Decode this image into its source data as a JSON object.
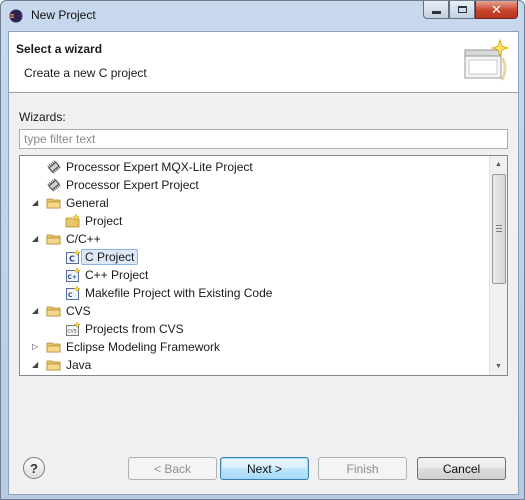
{
  "window": {
    "title": "New Project"
  },
  "banner": {
    "title": "Select a wizard",
    "description": "Create a new C project"
  },
  "wizards_label": "Wizards:",
  "filter": {
    "value": "",
    "placeholder": "type filter text"
  },
  "tree": {
    "items": [
      {
        "label": "Processor Expert MQX-Lite Project",
        "level": 0,
        "expander": "none",
        "icon": "chip-icon"
      },
      {
        "label": "Processor Expert Project",
        "level": 0,
        "expander": "none",
        "icon": "chip-icon"
      },
      {
        "label": "General",
        "level": 0,
        "expander": "expanded",
        "icon": "folder-icon"
      },
      {
        "label": "Project",
        "level": 1,
        "expander": "none",
        "icon": "project-icon"
      },
      {
        "label": "C/C++",
        "level": 0,
        "expander": "expanded",
        "icon": "folder-icon"
      },
      {
        "label": "C Project",
        "level": 1,
        "expander": "none",
        "icon": "c-project-icon",
        "selected": true
      },
      {
        "label": "C++ Project",
        "level": 1,
        "expander": "none",
        "icon": "cpp-project-icon"
      },
      {
        "label": "Makefile Project with Existing Code",
        "level": 1,
        "expander": "none",
        "icon": "makefile-project-icon"
      },
      {
        "label": "CVS",
        "level": 0,
        "expander": "expanded",
        "icon": "folder-icon"
      },
      {
        "label": "Projects from CVS",
        "level": 1,
        "expander": "none",
        "icon": "cvs-project-icon"
      },
      {
        "label": "Eclipse Modeling Framework",
        "level": 0,
        "expander": "collapsed",
        "icon": "folder-icon"
      },
      {
        "label": "Java",
        "level": 0,
        "expander": "expanded",
        "icon": "folder-icon"
      }
    ]
  },
  "buttons": {
    "back": "< Back",
    "next": "Next >",
    "finish": "Finish",
    "cancel": "Cancel",
    "help": "?"
  },
  "colors": {
    "selection_fill": "#dde8f7",
    "selection_border": "#8db3e2",
    "folder": "#e8c66a"
  }
}
